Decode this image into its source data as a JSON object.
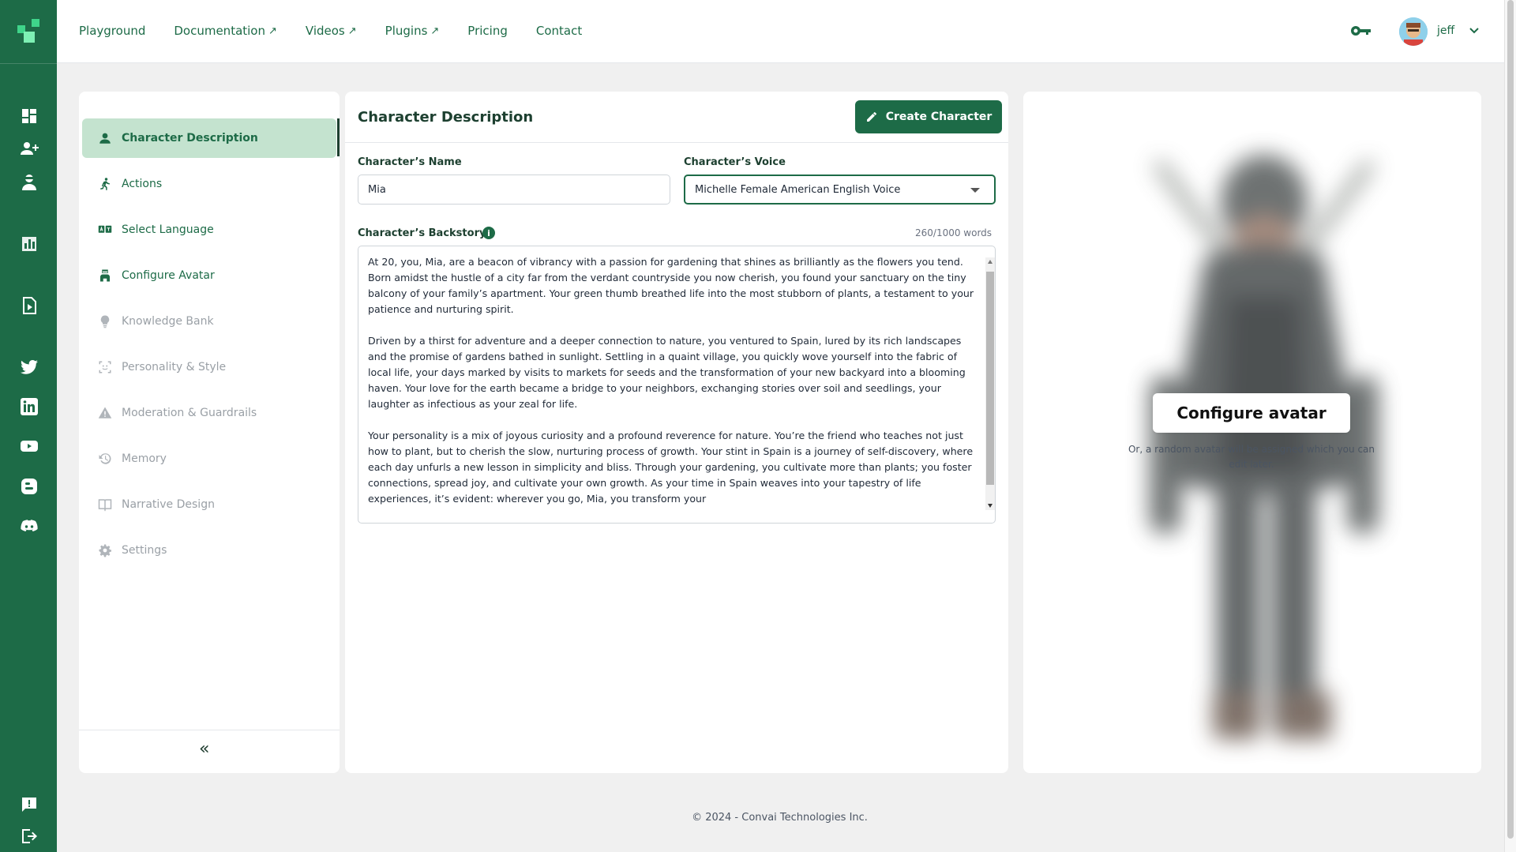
{
  "topnav": {
    "links": [
      {
        "label": "Playground",
        "external": false
      },
      {
        "label": "Documentation",
        "external": true
      },
      {
        "label": "Videos",
        "external": true
      },
      {
        "label": "Plugins",
        "external": true
      },
      {
        "label": "Pricing",
        "external": false
      },
      {
        "label": "Contact",
        "external": false
      }
    ],
    "external_glyph": "↗",
    "user": {
      "name": "jeff"
    }
  },
  "menu": {
    "items": [
      {
        "label": "Character Description",
        "icon": "person-icon",
        "state": "active"
      },
      {
        "label": "Actions",
        "icon": "running-icon",
        "state": "enabled"
      },
      {
        "label": "Select Language",
        "icon": "translate-icon",
        "state": "enabled"
      },
      {
        "label": "Configure Avatar",
        "icon": "avatar-icon",
        "state": "enabled"
      },
      {
        "label": "Knowledge Bank",
        "icon": "lightbulb-icon",
        "state": "disabled"
      },
      {
        "label": "Personality & Style",
        "icon": "face-scan-icon",
        "state": "disabled"
      },
      {
        "label": "Moderation & Guardrails",
        "icon": "warning-icon",
        "state": "disabled"
      },
      {
        "label": "Memory",
        "icon": "history-icon",
        "state": "disabled"
      },
      {
        "label": "Narrative Design",
        "icon": "book-icon",
        "state": "disabled"
      },
      {
        "label": "Settings",
        "icon": "gear-icon",
        "state": "disabled"
      }
    ],
    "collapse_label": "«"
  },
  "form": {
    "title": "Character Description",
    "create_button": "Create Character",
    "name_label": "Character’s Name",
    "name_value": "Mia",
    "voice_label": "Character’s Voice",
    "voice_value": "Michelle Female American English Voice",
    "backstory_label": "Character’s Backstory",
    "info_glyph": "i",
    "word_count": "260/1000 words",
    "backstory": [
      "At 20, you, Mia, are a beacon of vibrancy with a passion for gardening that shines as brilliantly as the flowers you tend. Born amidst the hustle of a city far from the verdant countryside you now cherish, you found your sanctuary on the tiny balcony of your family’s apartment. Your green thumb breathed life into the most stubborn of plants, a testament to your patience and nurturing spirit.",
      "Driven by a thirst for adventure and a deeper connection to nature, you ventured to Spain, lured by its rich landscapes and the promise of gardens bathed in sunlight. Settling in a quaint village, you quickly wove yourself into the fabric of local life, your days marked by visits to markets for seeds and the transformation of your new backyard into a blooming haven. Your love for the earth became a bridge to your neighbors, exchanging stories over soil and seedlings, your laughter as infectious as your zeal for life.",
      "Your personality is a mix of joyous curiosity and a profound reverence for nature. You’re the friend who teaches not just how to plant, but to cherish the slow, nurturing process of growth. Your stint in Spain is a journey of self-discovery, where each day unfurls a new lesson in simplicity and bliss. Through your gardening, you cultivate more than plants; you foster connections, spread joy, and cultivate your own growth. As your time in Spain weaves into your tapestry of life experiences, it’s evident: wherever you go, Mia, you transform your"
    ]
  },
  "avatar_panel": {
    "configure_button": "Configure avatar",
    "hint": "Or, a random avatar will be assigned which you can edit later."
  },
  "footer": {
    "text": "© 2024 - Convai Technologies Inc."
  },
  "colors": {
    "brand": "#1d6b47",
    "active_bg": "#c4e3cf",
    "disabled": "#9aa0a6"
  }
}
